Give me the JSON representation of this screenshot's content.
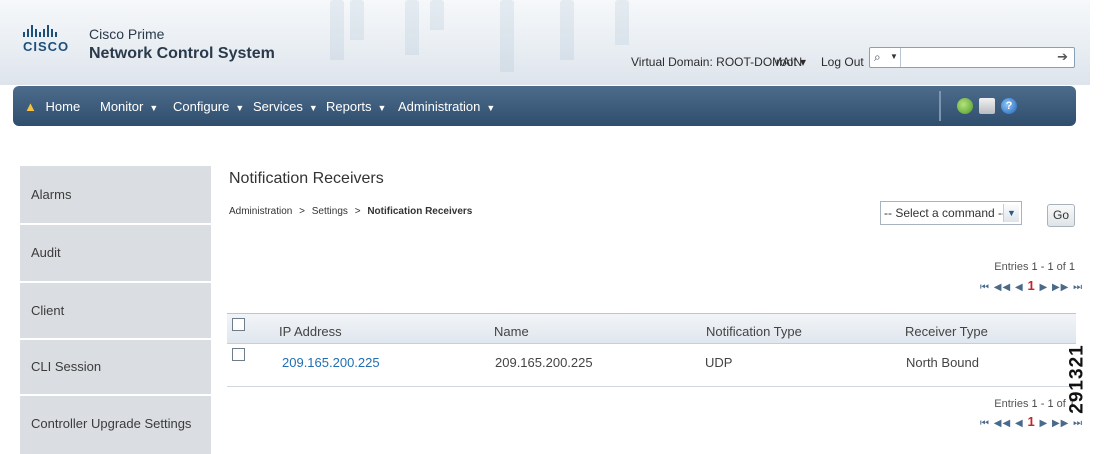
{
  "app": {
    "brand_line1": "Cisco Prime",
    "brand_line2": "Network Control System",
    "logo_word": "CISCO"
  },
  "header": {
    "virtual_domain": "Virtual Domain: ROOT-DOMAIN",
    "user_menu": "root ▾",
    "logout": "Log Out",
    "search_value": "",
    "search_icon": "search-icon",
    "go_icon": "arrow-right-icon"
  },
  "nav": {
    "items": [
      {
        "label": "Home",
        "icon": "home-icon"
      },
      {
        "label": "Monitor",
        "has_menu": true
      },
      {
        "label": "Configure",
        "has_menu": true
      },
      {
        "label": "Services",
        "has_menu": true
      },
      {
        "label": "Reports",
        "has_menu": true
      },
      {
        "label": "Administration",
        "has_menu": true
      }
    ],
    "tools": [
      "refresh-icon",
      "print-icon",
      "help-icon"
    ]
  },
  "sidebar": {
    "items": [
      {
        "label": "Alarms"
      },
      {
        "label": "Audit"
      },
      {
        "label": "Client"
      },
      {
        "label": "CLI Session"
      },
      {
        "label": "Controller Upgrade Settings"
      }
    ]
  },
  "page": {
    "title": "Notification Receivers",
    "breadcrumb": [
      "Administration",
      "Settings",
      "Notification Receivers"
    ],
    "breadcrumb_sep": ">",
    "command_select": "-- Select a command --",
    "go_label": "Go",
    "entries_prefix": "Entries",
    "entries_range": "1 - 1",
    "entries_of": "of",
    "entries_total": "1",
    "pager": {
      "first": "⏮",
      "prev_group": "◀◀",
      "prev": "◀",
      "current": "1",
      "next": "▶",
      "next_group": "▶▶",
      "last": "⏭"
    }
  },
  "table": {
    "columns": [
      "IP Address",
      "Name",
      "Notification Type",
      "Receiver Type"
    ],
    "rows": [
      {
        "ip": "209.165.200.225",
        "name": "209.165.200.225",
        "type": "UDP",
        "receiver": "North Bound"
      }
    ]
  },
  "figure_id": "291321",
  "colors": {
    "nav_bar": "#3a5878",
    "link": "#1f6fb2",
    "sidebar": "#dadde1",
    "pager_current": "#c62424"
  }
}
